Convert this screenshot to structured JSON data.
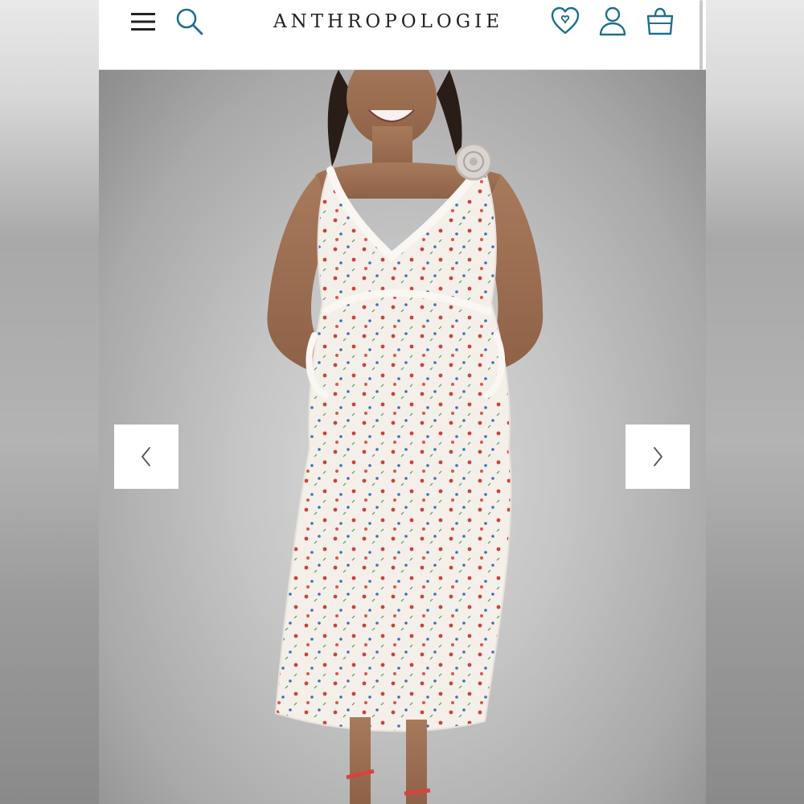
{
  "header": {
    "brand": "ANTHROPOLOGIE",
    "menu_icon": "hamburger-menu-icon",
    "search_icon": "search-icon",
    "wishlist_icon": "heart-icon",
    "account_icon": "user-icon",
    "bag_icon": "shopping-bag-icon"
  },
  "carousel": {
    "prev_icon": "chevron-left-icon",
    "next_icon": "chevron-right-icon"
  },
  "colors": {
    "accent": "#1f6f8b",
    "brand_text": "#222222"
  }
}
